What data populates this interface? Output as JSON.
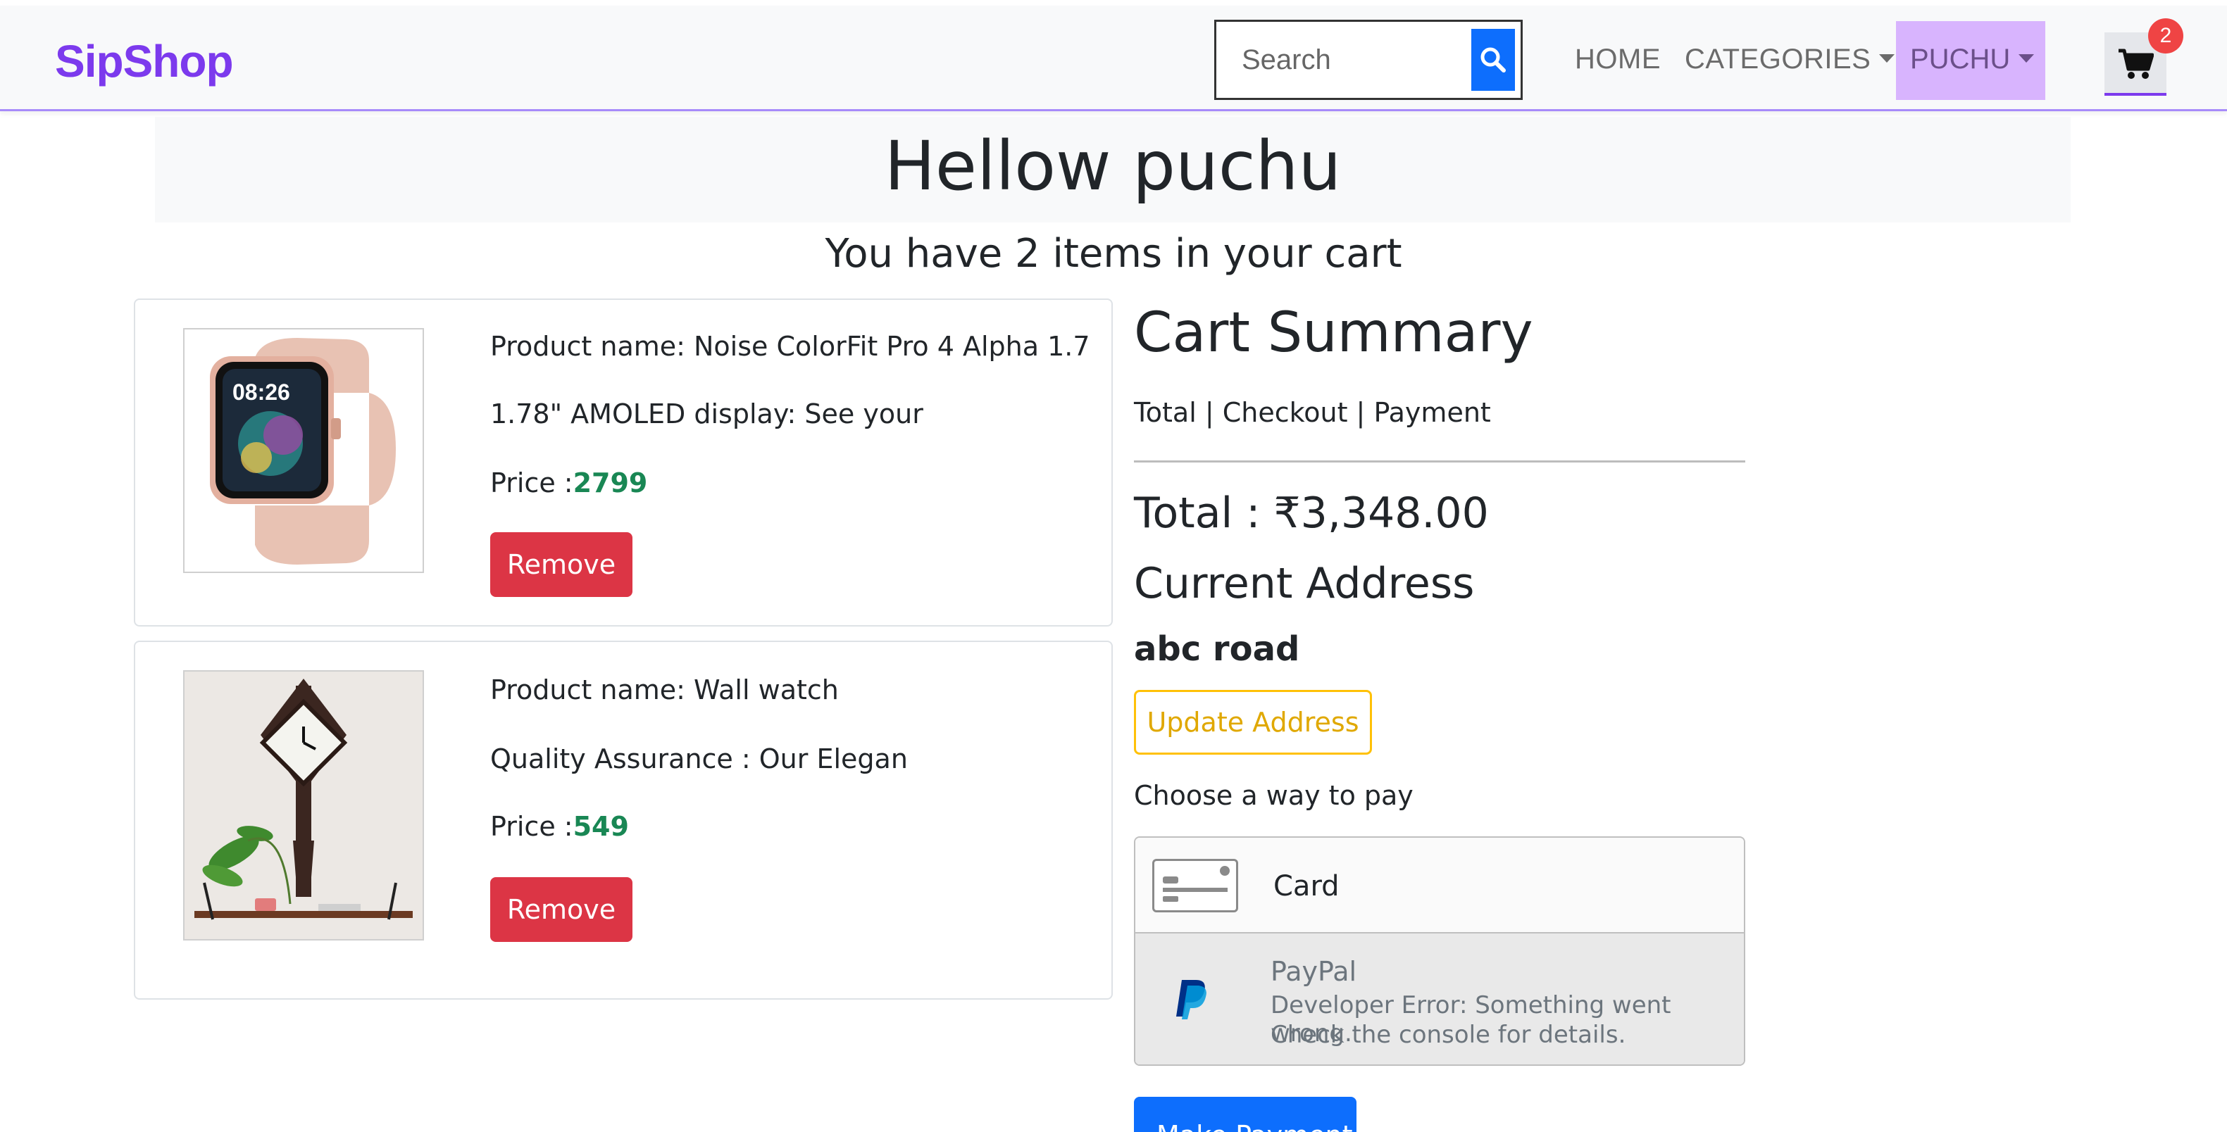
{
  "navbar": {
    "brand": "SipShop",
    "search_placeholder": "Search",
    "links": {
      "home": "HOME",
      "categories": "CATEGORIES",
      "user": "PUCHU"
    },
    "cart_count": "2",
    "brand_color": "#7c3aed"
  },
  "header": {
    "greeting": "Hellow puchu",
    "items_count": "You have 2 items in your cart"
  },
  "cart_items": [
    {
      "name": "Product name: Noise ColorFit Pro 4 Alpha 1.7",
      "description": "1.78\" AMOLED display: See your",
      "price_label": "Price :",
      "price": "2799",
      "remove_label": "Remove",
      "image_icon": "smartwatch-image"
    },
    {
      "name": "Product name: Wall watch",
      "description": "Quality Assurance : Our Elegan",
      "price_label": "Price :",
      "price": "549",
      "remove_label": "Remove",
      "image_icon": "wall-clock-image"
    }
  ],
  "summary": {
    "title": "Cart Summary",
    "subtitle": "Total | Checkout | Payment",
    "total": "Total : ₹3,348.00",
    "address_title": "Current Address",
    "address": "abc road",
    "update_address_label": "Update Address",
    "choose_payment": "Choose a way to pay",
    "payment_options": {
      "card": "Card",
      "paypal": "PayPal",
      "paypal_error_line1": "Developer Error: Something went wrong.",
      "paypal_error_line2": "Check the console for details."
    },
    "make_payment_label": "Make Payment"
  },
  "colors": {
    "danger": "#dc3545",
    "warning": "#ffc107",
    "primary": "#0d6efd",
    "price": "#198754",
    "user_highlight": "#d8b4fe"
  }
}
